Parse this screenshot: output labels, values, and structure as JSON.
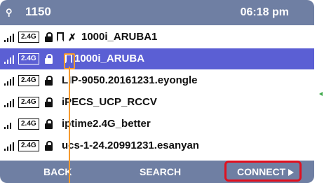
{
  "status": {
    "ext_icon": "phone-ext-icon",
    "extension": "1150",
    "time": "06:18 pm"
  },
  "wifi_list": [
    {
      "band": "2.4G",
      "ssid": "1000i_ARUBA1",
      "secured": true,
      "saved": true,
      "config": true,
      "selected": false
    },
    {
      "band": "2.4G",
      "ssid": "1000i_ARUBA",
      "secured": true,
      "saved": true,
      "config": false,
      "selected": true
    },
    {
      "band": "2.4G",
      "ssid": "LIP-9050.20161231.eyongle",
      "secured": true,
      "saved": false,
      "config": false,
      "selected": false
    },
    {
      "band": "2.4G",
      "ssid": "iPECS_UCP_RCCV",
      "secured": true,
      "saved": false,
      "config": false,
      "selected": false
    },
    {
      "band": "2.4G",
      "ssid": "iptime2.4G_better",
      "secured": true,
      "saved": false,
      "config": false,
      "selected": false
    },
    {
      "band": "2.4G",
      "ssid": "ucs-1-24.20991231.esanyan",
      "secured": true,
      "saved": false,
      "config": false,
      "selected": false
    }
  ],
  "softkeys": {
    "back": "BACK",
    "search": "SEARCH",
    "connect": "CONNECT"
  },
  "colors": {
    "bar": "#6f7fa3",
    "selected": "#5b5fd4",
    "callout_orange": "#f59a2e",
    "callout_red": "#e0101f"
  }
}
